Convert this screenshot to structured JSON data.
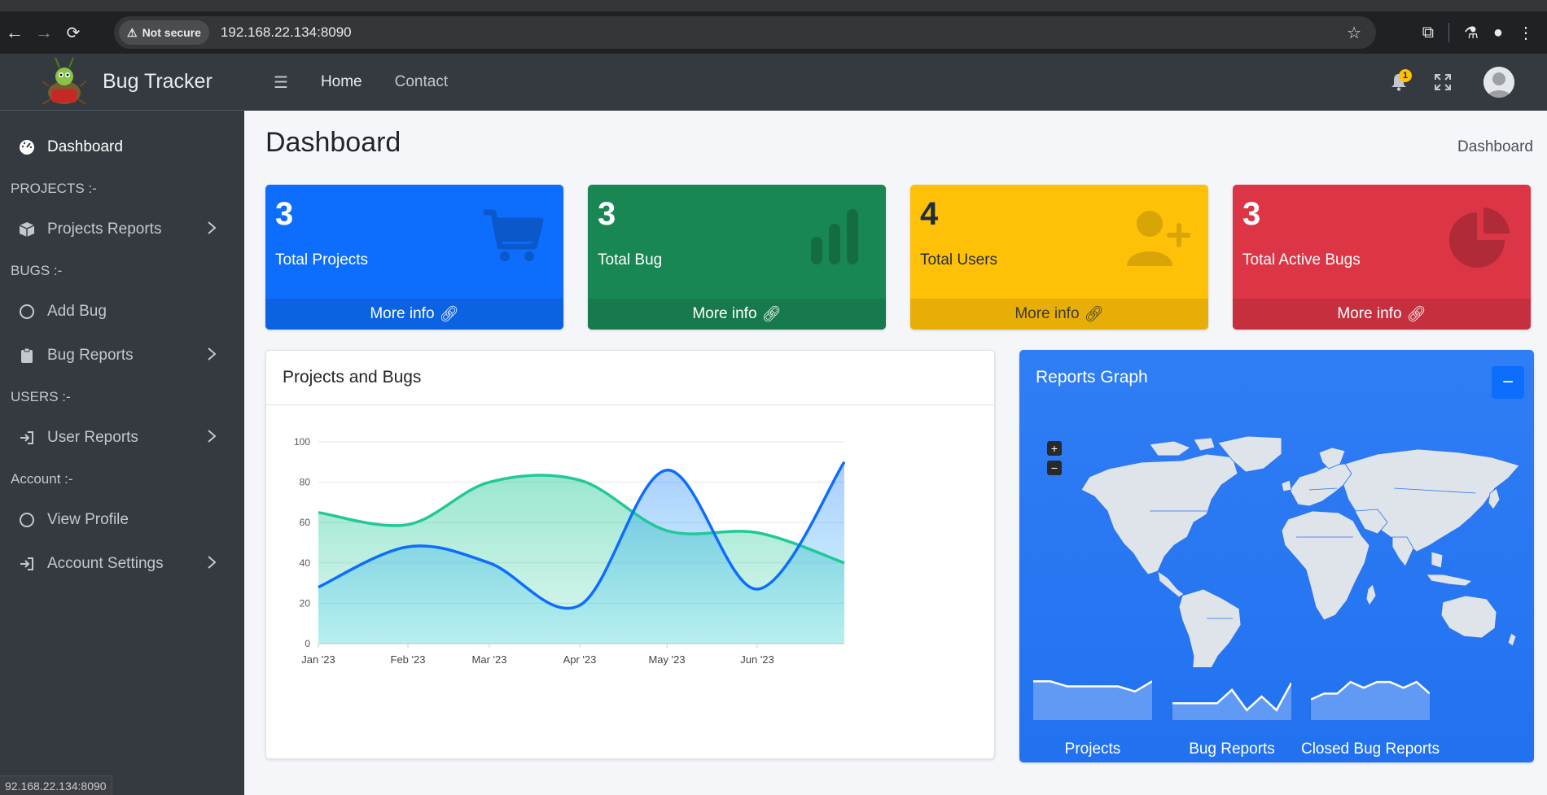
{
  "browser": {
    "security_label": "Not secure",
    "url": "192.168.22.134:8090",
    "status_url": "92.168.22.134:8090"
  },
  "brand": {
    "name": "Bug Tracker"
  },
  "sidebar": {
    "items": [
      {
        "type": "item",
        "label": "Dashboard",
        "icon": "gauge-icon",
        "active": true
      },
      {
        "type": "header",
        "label": "PROJECTS :-"
      },
      {
        "type": "item",
        "label": "Projects Reports",
        "icon": "box-icon",
        "chevron": true
      },
      {
        "type": "header",
        "label": "BUGS :-"
      },
      {
        "type": "item",
        "label": "Add Bug",
        "icon": "circle-icon"
      },
      {
        "type": "item",
        "label": "Bug Reports",
        "icon": "clipboard-icon",
        "chevron": true
      },
      {
        "type": "header",
        "label": "USERS :-"
      },
      {
        "type": "item",
        "label": "User Reports",
        "icon": "sign-in-icon",
        "chevron": true
      },
      {
        "type": "header",
        "label": "Account :-"
      },
      {
        "type": "item",
        "label": "View Profile",
        "icon": "circle-icon"
      },
      {
        "type": "item",
        "label": "Account Settings",
        "icon": "sign-in-icon",
        "chevron": true
      }
    ]
  },
  "topbar": {
    "links": [
      "Home",
      "Contact"
    ],
    "notification_count": "1"
  },
  "page": {
    "title": "Dashboard",
    "breadcrumb": "Dashboard"
  },
  "stats": [
    {
      "value": "3",
      "label": "Total Projects",
      "footer": "More info",
      "color": "#0d6efd",
      "icon": "cart-icon"
    },
    {
      "value": "3",
      "label": "Total Bug",
      "footer": "More info",
      "color": "#198754",
      "icon": "bar-chart-icon"
    },
    {
      "value": "4",
      "label": "Total Users",
      "footer": "More info",
      "color": "#ffc107",
      "icon": "user-plus-icon"
    },
    {
      "value": "3",
      "label": "Total Active Bugs",
      "footer": "More info",
      "color": "#dc3545",
      "icon": "pie-chart-icon"
    }
  ],
  "chart_card": {
    "title": "Projects and Bugs"
  },
  "map_card": {
    "title": "Reports Graph",
    "sparklines": [
      {
        "label": "Projects",
        "values": [
          7,
          7,
          6,
          6,
          6,
          6,
          5,
          7
        ]
      },
      {
        "label": "Bug Reports",
        "values": [
          2,
          2,
          2,
          2,
          4,
          1,
          3,
          1,
          5
        ]
      },
      {
        "label": "Closed Bug Reports",
        "values": [
          3,
          4,
          4,
          6,
          5,
          6,
          6,
          5,
          6,
          4
        ]
      }
    ]
  },
  "chart_data": {
    "type": "area",
    "categories": [
      "Jan '23",
      "Feb '23",
      "Mar '23",
      "Apr '23",
      "May '23",
      "Jun '23",
      ""
    ],
    "ylim": [
      0,
      100
    ],
    "yticks": [
      0,
      20,
      40,
      60,
      80,
      100
    ],
    "series": [
      {
        "values": [
          65,
          59,
          80,
          81,
          56,
          55,
          40
        ],
        "color": "#20c997"
      },
      {
        "values": [
          28,
          48,
          40,
          19,
          86,
          27,
          90
        ],
        "color": "#0d6efd"
      }
    ],
    "grid": true
  }
}
